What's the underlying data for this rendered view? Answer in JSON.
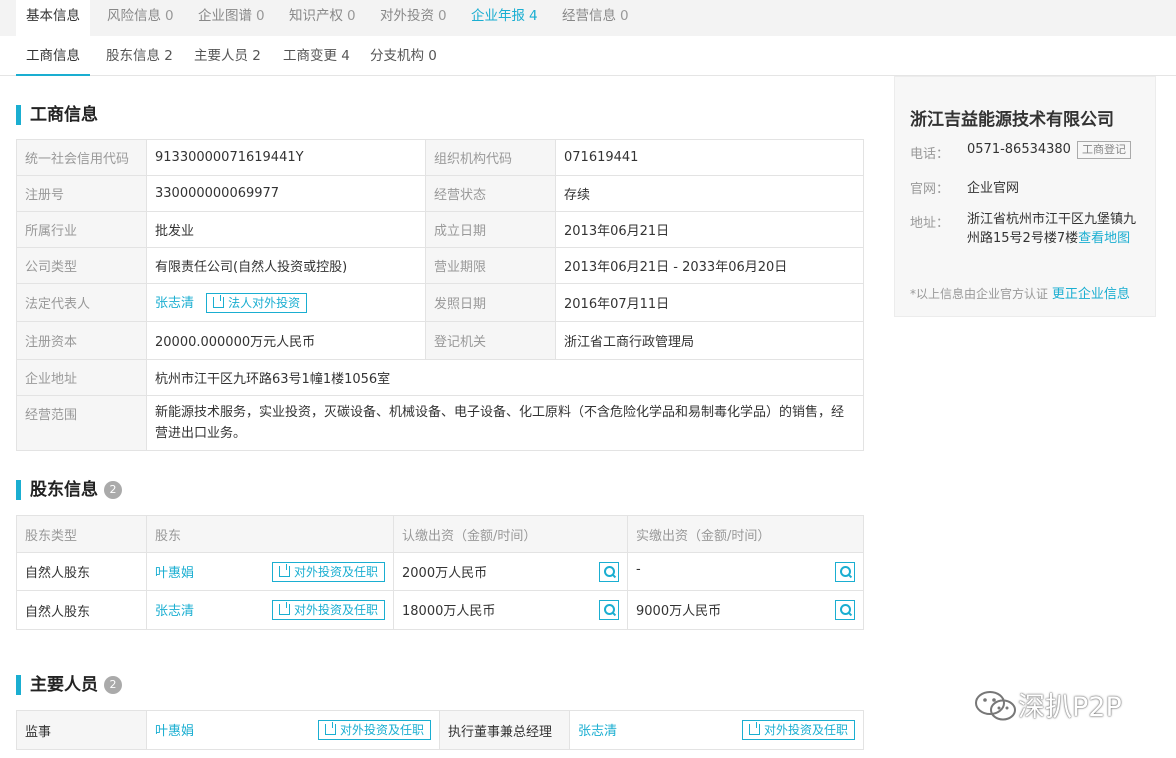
{
  "top_tabs": [
    {
      "label": "基本信息",
      "count": ""
    },
    {
      "label": "风险信息",
      "count": "0"
    },
    {
      "label": "企业图谱",
      "count": "0"
    },
    {
      "label": "知识产权",
      "count": "0"
    },
    {
      "label": "对外投资",
      "count": "0"
    },
    {
      "label": "企业年报",
      "count": "4"
    },
    {
      "label": "经营信息",
      "count": "0"
    }
  ],
  "sub_tabs": [
    {
      "label": "工商信息"
    },
    {
      "label": "股东信息 2"
    },
    {
      "label": "主要人员 2"
    },
    {
      "label": "工商变更 4"
    },
    {
      "label": "分支机构 0"
    }
  ],
  "business": {
    "title": "工商信息",
    "credit_code_label": "统一社会信用代码",
    "credit_code": "91330000071619441Y",
    "org_code_label": "组织机构代码",
    "org_code": "071619441",
    "reg_no_label": "注册号",
    "reg_no": "330000000069977",
    "status_label": "经营状态",
    "status": "存续",
    "industry_label": "所属行业",
    "industry": "批发业",
    "founded_label": "成立日期",
    "founded": "2013年06月21日",
    "company_type_label": "公司类型",
    "company_type": "有限责任公司(自然人投资或控股)",
    "term_label": "营业期限",
    "term": "2013年06月21日 - 2033年06月20日",
    "legal_rep_label": "法定代表人",
    "legal_rep": "张志清",
    "legal_rep_btn": "法人对外投资",
    "issue_date_label": "发照日期",
    "issue_date": "2016年07月11日",
    "capital_label": "注册资本",
    "capital": "20000.000000万元人民币",
    "authority_label": "登记机关",
    "authority": "浙江省工商行政管理局",
    "address_label": "企业地址",
    "address": "杭州市江干区九环路63号1幢1楼1056室",
    "scope_label": "经营范围",
    "scope": "新能源技术服务，实业投资，灭碳设备、机械设备、电子设备、化工原料（不含危险化学品和易制毒化学品）的销售，经营进出口业务。"
  },
  "shareholders": {
    "title": "股东信息",
    "count": "2",
    "headers": [
      "股东类型",
      "股东",
      "认缴出资（金额/时间）",
      "实缴出资（金额/时间）"
    ],
    "rows": [
      {
        "type": "自然人股东",
        "name": "叶惠娟",
        "btn": "对外投资及任职",
        "subscribed": "2000万人民币",
        "paid": "-"
      },
      {
        "type": "自然人股东",
        "name": "张志清",
        "btn": "对外投资及任职",
        "subscribed": "18000万人民币",
        "paid": "9000万人民币"
      }
    ]
  },
  "personnel": {
    "title": "主要人员",
    "count": "2",
    "items": [
      {
        "role": "监事",
        "name": "叶惠娟",
        "btn": "对外投资及任职"
      },
      {
        "role": "执行董事兼总经理",
        "name": "张志清",
        "btn": "对外投资及任职"
      }
    ]
  },
  "sidebar": {
    "company": "浙江吉益能源技术有限公司",
    "phone_label": "电话：",
    "phone": "0571-86534380",
    "phone_tag": "工商登记",
    "website_label": "官网：",
    "website": "企业官网",
    "address_label": "地址：",
    "address": "浙江省杭州市江干区九堡镇九州路15号2号楼7楼",
    "map_link": "查看地图",
    "note": "*以上信息由企业官方认证",
    "correct_link": "更正企业信息"
  },
  "watermark": {
    "text": "深扒P2P"
  },
  "colors": {
    "accent": "#1aaed1",
    "label_bg": "#f6f6f6",
    "border": "#e3e3e3"
  }
}
